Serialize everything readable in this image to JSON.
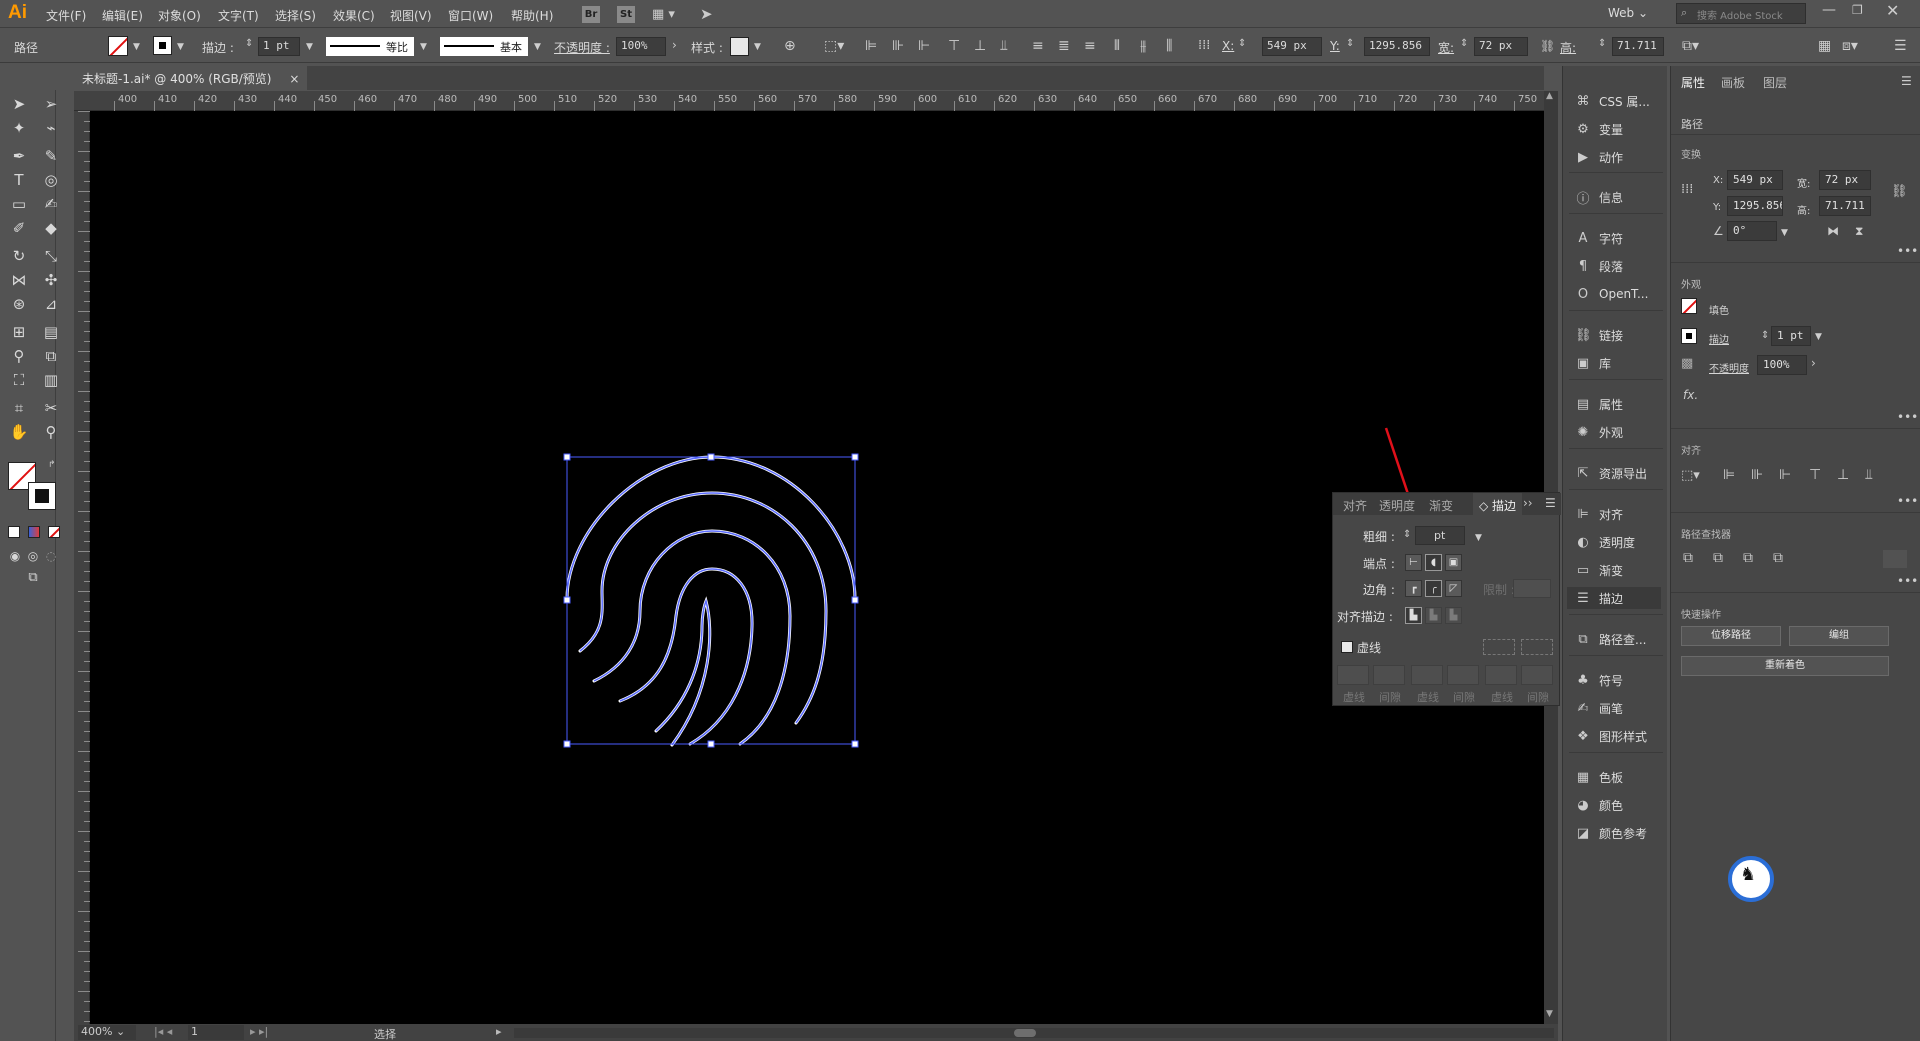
{
  "app": {
    "logo": "Ai",
    "menus": [
      "文件(F)",
      "编辑(E)",
      "对象(O)",
      "文字(T)",
      "选择(S)",
      "效果(C)",
      "视图(V)",
      "窗口(W)",
      "帮助(H)"
    ],
    "bridge_btn": "Br",
    "stock_btn": "St",
    "workspace": "Web",
    "search_placeholder": "搜索 Adobe Stock",
    "accent_color": "#ff9a00"
  },
  "control_bar": {
    "object_type": "路径",
    "stroke_label": "描边 :",
    "stroke_weight": "1 pt",
    "profile": "等比",
    "brush": "基本",
    "opacity_label": "不透明度 :",
    "opacity": "100%",
    "style_label": "样式 :",
    "x_label": "X:",
    "x": "549 px",
    "y_label": "Y:",
    "y": "1295.856",
    "w_label": "宽:",
    "w": "72 px",
    "h_label": "高:",
    "h": "71.711 px"
  },
  "document": {
    "tab_title": "未标题-1.ai* @ 400% (RGB/预览)",
    "ruler_h": [
      "400",
      "410",
      "420",
      "430",
      "440",
      "450",
      "460",
      "470",
      "480",
      "490",
      "500",
      "510",
      "520",
      "530",
      "540",
      "550",
      "560",
      "570",
      "580",
      "590",
      "600",
      "610",
      "620",
      "630",
      "640",
      "650",
      "660",
      "670",
      "680",
      "690",
      "700",
      "710",
      "720",
      "730",
      "740",
      "750"
    ],
    "zoom": "400%",
    "artboard": "1",
    "status": "选择"
  },
  "dock": [
    {
      "label": "CSS 属...",
      "icon": "css-icon"
    },
    {
      "label": "变量",
      "icon": "variables-icon"
    },
    {
      "label": "动作",
      "icon": "play-icon"
    },
    {
      "label": "信息",
      "icon": "info-icon"
    },
    {
      "label": "字符",
      "icon": "character-icon"
    },
    {
      "label": "段落",
      "icon": "paragraph-icon"
    },
    {
      "label": "OpenT...",
      "icon": "opentype-icon"
    },
    {
      "label": "链接",
      "icon": "link-icon"
    },
    {
      "label": "库",
      "icon": "library-icon"
    },
    {
      "label": "属性",
      "icon": "properties-icon"
    },
    {
      "label": "外观",
      "icon": "appearance-icon"
    },
    {
      "label": "资源导出",
      "icon": "export-icon"
    },
    {
      "label": "对齐",
      "icon": "align-icon"
    },
    {
      "label": "透明度",
      "icon": "transparency-icon"
    },
    {
      "label": "渐变",
      "icon": "gradient-icon"
    },
    {
      "label": "描边",
      "icon": "stroke-icon"
    },
    {
      "label": "路径查...",
      "icon": "pathfinder-icon"
    },
    {
      "label": "符号",
      "icon": "symbol-icon"
    },
    {
      "label": "画笔",
      "icon": "brush-icon"
    },
    {
      "label": "图形样式",
      "icon": "graphic-style-icon"
    },
    {
      "label": "色板",
      "icon": "swatches-icon"
    },
    {
      "label": "颜色",
      "icon": "color-icon"
    },
    {
      "label": "颜色参考",
      "icon": "color-guide-icon"
    }
  ],
  "properties": {
    "tabs": [
      "属性",
      "画板",
      "图层"
    ],
    "object": "路径",
    "transform_title": "变换",
    "x_label": "X:",
    "x": "549 px",
    "y_label": "Y:",
    "y": "1295.856",
    "w_label": "宽:",
    "w": "72 px",
    "h_label": "高:",
    "h": "71.711 p",
    "angle": "0°",
    "appearance_title": "外观",
    "fill_label": "填色",
    "stroke_label": "描边",
    "stroke_value": "1 pt",
    "opacity_label": "不透明度",
    "opacity": "100%",
    "fx_label": "fx.",
    "align_title": "对齐",
    "pathfinder_title": "路径查找器",
    "quick_title": "快速操作",
    "offset_btn": "位移路径",
    "group_btn": "编组",
    "recolor_btn": "重新着色"
  },
  "stroke_panel": {
    "tabs": [
      "对齐",
      "透明度",
      "渐变",
      "描边"
    ],
    "weight_label": "粗细 :",
    "weight_unit": "pt",
    "cap_label": "端点 :",
    "corner_label": "边角 :",
    "limit_label": "限制 :",
    "align_label": "对齐描边 :",
    "dashed_label": "虚线",
    "dash_labels": [
      "虚线",
      "间隙",
      "虚线",
      "间隙",
      "虚线",
      "间隙"
    ]
  },
  "colors": {
    "canvas": "#000000",
    "selection": "#4a5dff",
    "arrow": "#e0101a",
    "stroke_path": "#ffffff"
  }
}
